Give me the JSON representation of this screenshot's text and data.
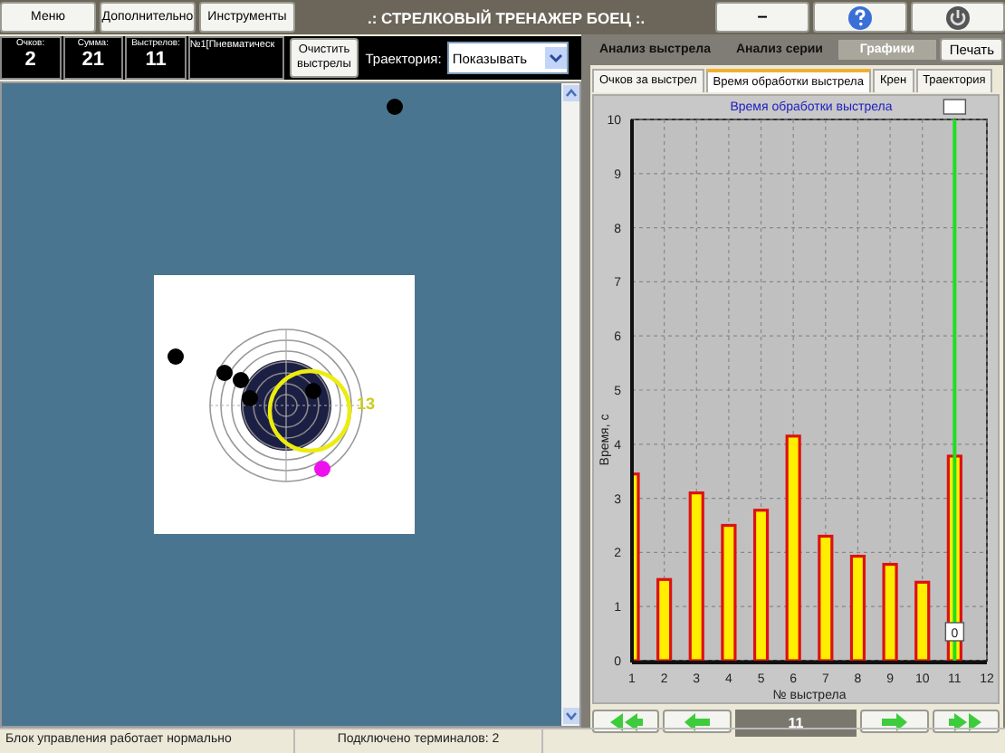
{
  "menu": [
    {
      "label": "Меню"
    },
    {
      "label": "Дополнительно"
    },
    {
      "label": "Инструменты"
    }
  ],
  "window": {
    "title": ".: СТРЕЛКОВЫЙ ТРЕНАЖЕР БОЕЦ :.",
    "minimize": "–"
  },
  "stats": [
    {
      "label": "Очков:",
      "value": "2"
    },
    {
      "label": "Сумма:",
      "value": "21"
    },
    {
      "label": "Выстрелов:",
      "value": "11"
    }
  ],
  "weapon": "№1[Пневматическ",
  "clear_button": "Очистить выстрелы",
  "trajectory": {
    "label": "Траектория:",
    "value": "Показывать"
  },
  "target": {
    "label": "13"
  },
  "tabs": [
    {
      "label": "Анализ выстрела",
      "selected": false
    },
    {
      "label": "Анализ серии",
      "selected": false
    },
    {
      "label": "Графики",
      "selected": true
    }
  ],
  "print_button": "Печать",
  "subtabs": [
    {
      "label": "Очков за выстрел",
      "selected": false
    },
    {
      "label": "Время обработки выстрела",
      "selected": true
    },
    {
      "label": "Крен",
      "selected": false
    },
    {
      "label": "Траектория",
      "selected": false
    }
  ],
  "chart_data": {
    "type": "bar",
    "title": "Время обработки выстрела",
    "xlabel": "№ выстрела",
    "ylabel": "Время, с",
    "x": [
      1,
      2,
      3,
      4,
      5,
      6,
      7,
      8,
      9,
      10,
      11
    ],
    "series": [
      {
        "color": "#ffee00",
        "values": [
          3.45,
          1.5,
          3.1,
          2.5,
          2.78,
          4.15,
          2.3,
          1.93,
          1.78,
          1.45,
          3.78
        ]
      }
    ],
    "xlim": [
      1,
      12
    ],
    "ylim": [
      0,
      10
    ],
    "xticks": [
      1,
      2,
      3,
      4,
      5,
      6,
      7,
      8,
      9,
      10,
      11,
      12
    ],
    "yticks": [
      0,
      1,
      2,
      3,
      4,
      5,
      6,
      7,
      8,
      9,
      10
    ],
    "grid": true,
    "ref_lines": [
      {
        "axis": "x",
        "value": 11,
        "color": "#22dd22"
      }
    ],
    "annotations": [
      {
        "x": 11,
        "y": 0,
        "text": "0"
      }
    ]
  },
  "navigator": {
    "value": "11"
  },
  "status_bar": [
    {
      "text": "Блок управления работает нормально"
    },
    {
      "text": "Подключено терминалов: 2"
    }
  ]
}
